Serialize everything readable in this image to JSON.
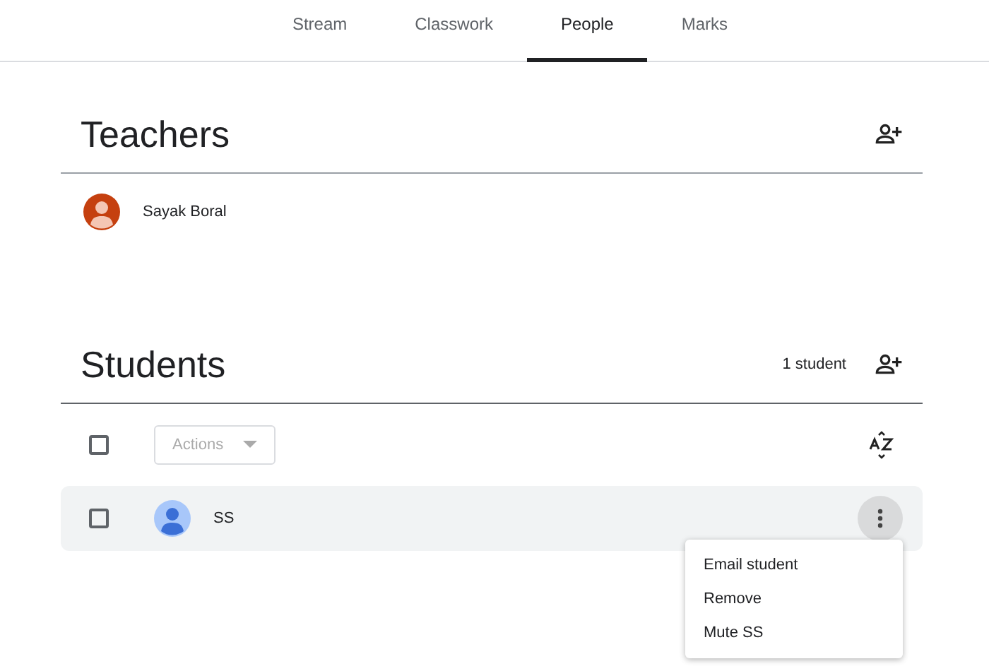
{
  "tabs": [
    {
      "label": "Stream",
      "selected": false
    },
    {
      "label": "Classwork",
      "selected": false
    },
    {
      "label": "People",
      "selected": true
    },
    {
      "label": "Marks",
      "selected": false
    }
  ],
  "teachers": {
    "title": "Teachers",
    "people": [
      {
        "name": "Sayak Boral"
      }
    ]
  },
  "students": {
    "title": "Students",
    "count": "1 student",
    "actions": {
      "label": "Actions",
      "disabled": true
    },
    "select_all": {
      "checked": false
    },
    "people": [
      {
        "name": "SS",
        "checked": false,
        "menu_open": true
      }
    ]
  },
  "menu": {
    "items": [
      "Email student",
      "Remove",
      "Mute SS"
    ]
  }
}
